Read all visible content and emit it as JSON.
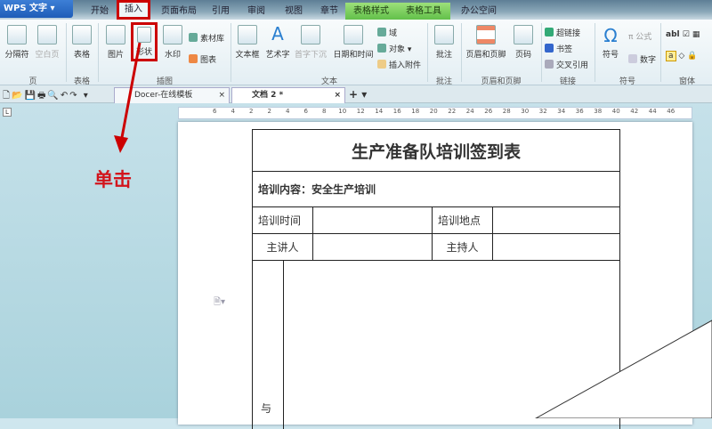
{
  "app": {
    "title": "WPS 文字"
  },
  "menu_tabs": [
    "开始",
    "插入",
    "页面布局",
    "引用",
    "审阅",
    "视图",
    "章节",
    "表格样式",
    "表格工具",
    "办公空间"
  ],
  "ribbon": {
    "buttons": [
      "分隔符",
      "空白页",
      "表格",
      "图片",
      "形状",
      "水印",
      "文本框",
      "艺术字",
      "首字下沉",
      "日期和时间",
      "批注",
      "页眉和页脚",
      "页码",
      "符号"
    ],
    "small": [
      "素材库",
      "图表",
      "域",
      "对象",
      "插入附件",
      "超链接",
      "书签",
      "交叉引用",
      "公式",
      "数字"
    ],
    "groups": [
      "页",
      "表格",
      "插图",
      "文本",
      "批注",
      "页眉和页脚",
      "链接",
      "符号",
      "窗体"
    ]
  },
  "doc_tabs": [
    {
      "label": "Docer-在线模板"
    },
    {
      "label": "文档 2 *"
    }
  ],
  "ruler_ticks": [
    "6",
    "4",
    "2",
    "2",
    "4",
    "6",
    "8",
    "10",
    "12",
    "14",
    "16",
    "18",
    "20",
    "22",
    "24",
    "26",
    "28",
    "30",
    "32",
    "34",
    "36",
    "38",
    "40",
    "42",
    "44",
    "46"
  ],
  "annotation": "单击",
  "document": {
    "title": "生产准备队培训签到表",
    "content_label": "培训内容：安全生产培训",
    "time_label": "培训时间",
    "place_label": "培训地点",
    "speaker_label": "主讲人",
    "host_label": "主持人",
    "side_char": "与"
  }
}
